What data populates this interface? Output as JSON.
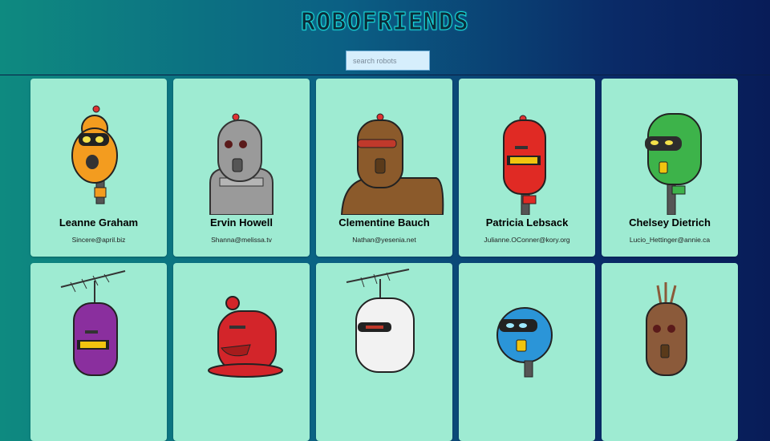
{
  "app": {
    "title": "ROBOFRIENDS"
  },
  "search": {
    "placeholder": "search robots",
    "value": ""
  },
  "robots": [
    {
      "name": "Leanne Graham",
      "email": "Sincere@april.biz",
      "color": "#f39c1f"
    },
    {
      "name": "Ervin Howell",
      "email": "Shanna@melissa.tv",
      "color": "#9a9a9a"
    },
    {
      "name": "Clementine Bauch",
      "email": "Nathan@yesenia.net",
      "color": "#8b5a2b"
    },
    {
      "name": "Patricia Lebsack",
      "email": "Julianne.OConner@kory.org",
      "color": "#e02a24"
    },
    {
      "name": "Chelsey Dietrich",
      "email": "Lucio_Hettinger@annie.ca",
      "color": "#3db34a"
    },
    {
      "name": "",
      "email": "",
      "color": "#8a2f9e"
    },
    {
      "name": "",
      "email": "",
      "color": "#d3252a"
    },
    {
      "name": "",
      "email": "",
      "color": "#f2f2f2"
    },
    {
      "name": "",
      "email": "",
      "color": "#2b95d8"
    },
    {
      "name": "",
      "email": "",
      "color": "#8b5a3a"
    }
  ]
}
